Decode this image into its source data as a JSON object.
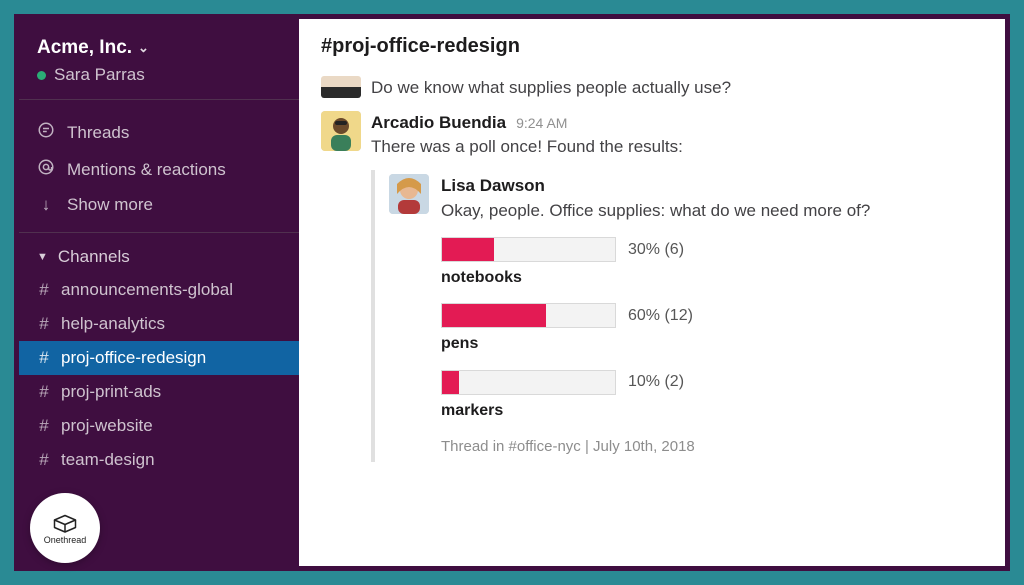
{
  "workspace": {
    "name": "Acme, Inc.",
    "user": "Sara Parras"
  },
  "nav": {
    "threads": "Threads",
    "mentions": "Mentions & reactions",
    "show_more": "Show more"
  },
  "channels": {
    "header": "Channels",
    "items": [
      {
        "name": "announcements-global",
        "selected": false
      },
      {
        "name": "help-analytics",
        "selected": false
      },
      {
        "name": "proj-office-redesign",
        "selected": true
      },
      {
        "name": "proj-print-ads",
        "selected": false
      },
      {
        "name": "proj-website",
        "selected": false
      },
      {
        "name": "team-design",
        "selected": false
      }
    ]
  },
  "main": {
    "channel_title": "#proj-office-redesign",
    "prev_message": "Do we know what supplies people actually use?",
    "message": {
      "author": "Arcadio Buendia",
      "time": "9:24 AM",
      "text": "There was a poll once! Found the results:"
    },
    "quoted": {
      "author": "Lisa Dawson",
      "text": "Okay, people. Office supplies: what do we need more of?",
      "poll": [
        {
          "label": "notebooks",
          "percent": 30,
          "count": 6,
          "display": "30% (6)"
        },
        {
          "label": "pens",
          "percent": 60,
          "count": 12,
          "display": "60% (12)"
        },
        {
          "label": "markers",
          "percent": 10,
          "count": 2,
          "display": "10% (2)"
        }
      ],
      "thread_meta": "Thread in #office-nyc | July 10th, 2018"
    }
  },
  "logo": "Onethread",
  "chart_data": {
    "type": "bar",
    "title": "Office supplies: what do we need more of?",
    "categories": [
      "notebooks",
      "pens",
      "markers"
    ],
    "values": [
      30,
      60,
      10
    ],
    "counts": [
      6,
      12,
      2
    ],
    "xlabel": "",
    "ylabel": "percent",
    "ylim": [
      0,
      100
    ]
  }
}
